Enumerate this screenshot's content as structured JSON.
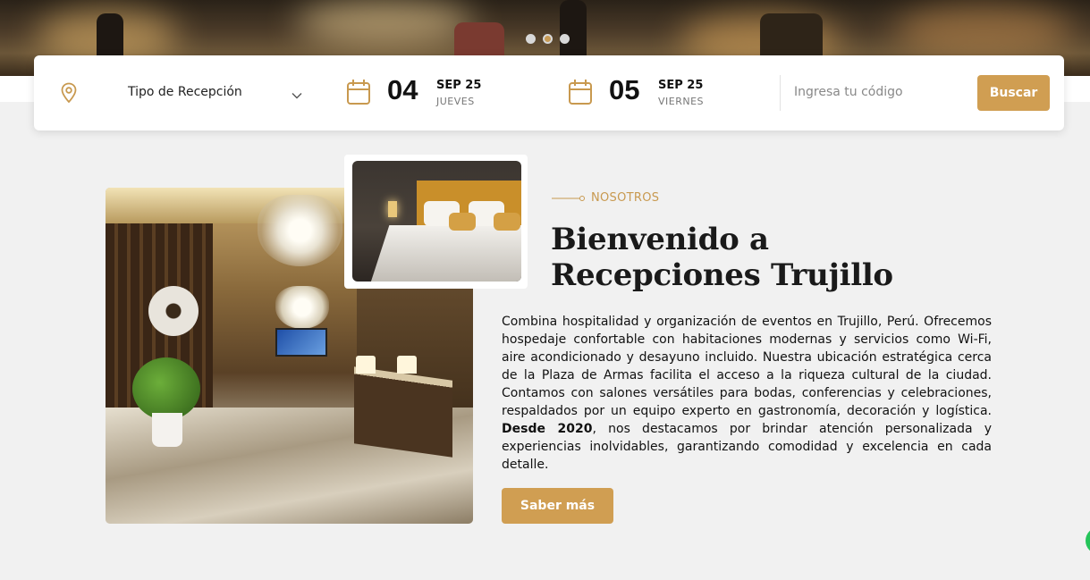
{
  "colors": {
    "accent": "#d09e52",
    "eyebrow": "#c8994f",
    "background": "#f1f1f1"
  },
  "carousel": {
    "dots": 3,
    "active": 2
  },
  "booking": {
    "reception_type": "Tipo de Recepción",
    "checkin": {
      "day": "04",
      "month": "SEP 25",
      "weekday": "JUEVES"
    },
    "checkout": {
      "day": "05",
      "month": "SEP 25",
      "weekday": "VIERNES"
    },
    "code_placeholder": "Ingresa tu código",
    "search_label": "Buscar"
  },
  "about": {
    "eyebrow": "NOSOTROS",
    "title_line1": "Bienvenido a",
    "title_line2": "Recepciones Trujillo",
    "paragraph_part1": "Combina hospitalidad y organización de eventos en Trujillo, Perú. Ofrecemos hospedaje confortable con habitaciones modernas y servicios como Wi-Fi, aire acondicionado y desayuno incluido. Nuestra ubicación estratégica cerca de la Plaza de Armas facilita el acceso a la riqueza cultural de la ciudad. Contamos con salones versátiles para bodas, conferencias y celebraciones, respaldados por un equipo experto en gastronomía, decoración y logística. ",
    "paragraph_bold": "Desde 2020",
    "paragraph_part2": ", nos destacamos por brindar atención personalizada y experiencias inolvidables, garantizando comodidad y excelencia en cada detalle.",
    "cta_label": "Saber más"
  }
}
